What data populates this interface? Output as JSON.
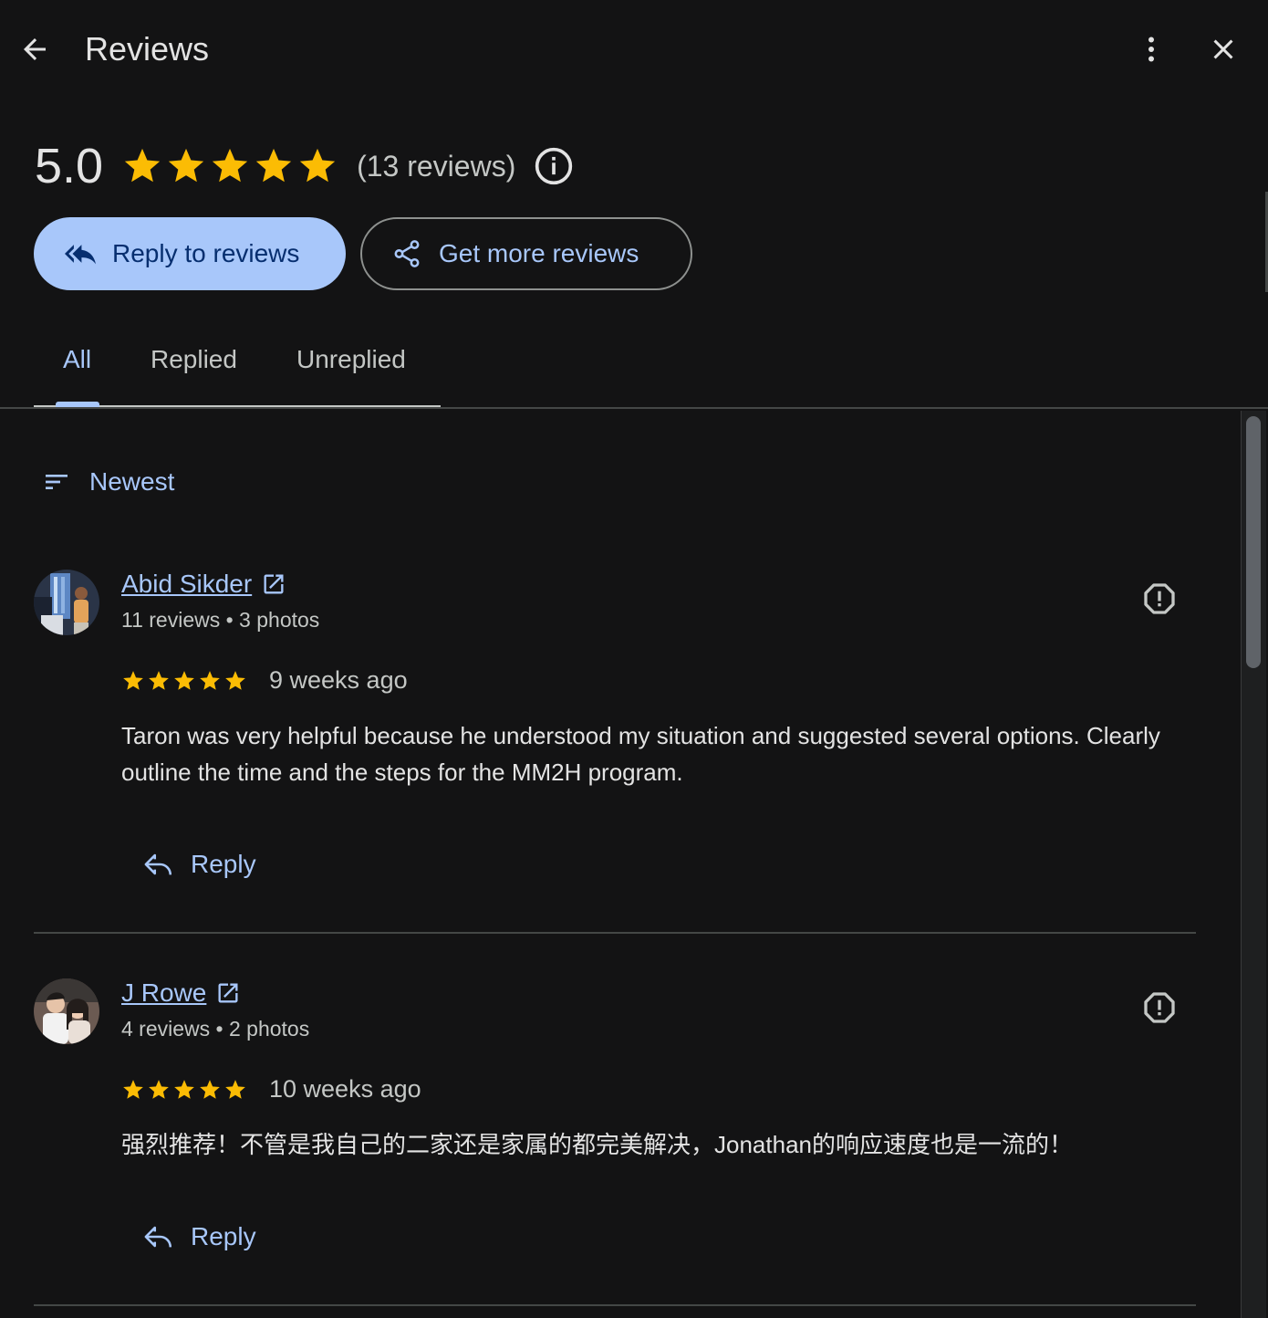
{
  "header": {
    "title": "Reviews"
  },
  "summary": {
    "rating": "5.0",
    "stars": 5,
    "count_text": "(13 reviews)"
  },
  "actions": {
    "reply_label": "Reply to reviews",
    "more_label": "Get more reviews"
  },
  "tabs": [
    {
      "label": "All",
      "active": true
    },
    {
      "label": "Replied",
      "active": false
    },
    {
      "label": "Unreplied",
      "active": false
    }
  ],
  "sort": {
    "label": "Newest"
  },
  "reviews": [
    {
      "author": "Abid Sikder",
      "meta": "11 reviews • 3 photos",
      "stars": 5,
      "date": "9 weeks ago",
      "text": "Taron was very helpful because he understood my situation and suggested several options. Clearly outline the time and the steps for the MM2H program.",
      "reply_label": "Reply"
    },
    {
      "author": "J Rowe",
      "meta": "4 reviews • 2 photos",
      "stars": 5,
      "date": "10 weeks ago",
      "text": "强烈推荐！不管是我自己的二家还是家属的都完美解决，Jonathan的响应速度也是一流的！",
      "reply_label": "Reply"
    }
  ],
  "colors": {
    "background": "#131314",
    "accent": "#a8c7fa",
    "star": "#fbbc04",
    "text": "#e3e3e3"
  }
}
